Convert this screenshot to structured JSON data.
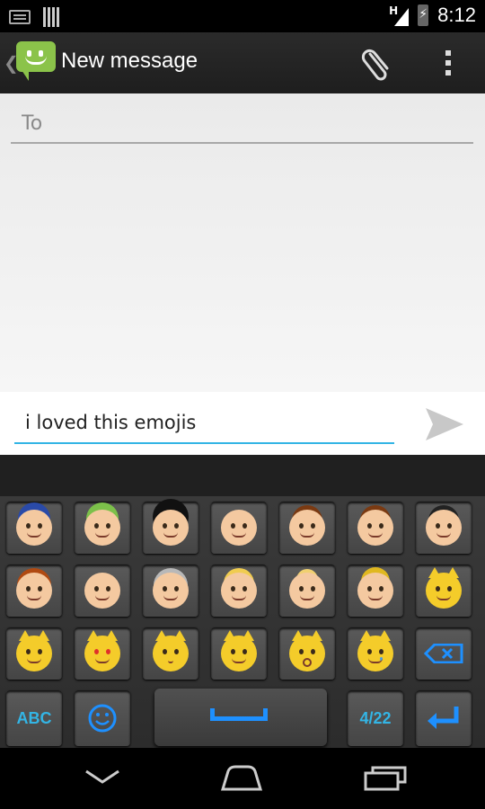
{
  "status_bar": {
    "time": "8:12",
    "network_label": "H",
    "icons": [
      "keyboard-icon",
      "barcode-icon",
      "signal-icon",
      "battery-charging-icon"
    ]
  },
  "action_bar": {
    "title": "New message",
    "icons": [
      "back-caret-icon",
      "messaging-app-icon",
      "paperclip-icon",
      "overflow-menu-icon"
    ]
  },
  "compose": {
    "to_placeholder": "To",
    "message_text": "i loved this emojis",
    "send_icon": "send-arrow-icon"
  },
  "keyboard": {
    "rows": [
      [
        "police-officer-emoji",
        "construction-worker-emoji",
        "guardsman-emoji",
        "baby-emoji",
        "boy-emoji",
        "girl-emoji",
        "man-emoji"
      ],
      [
        "woman-emoji",
        "older-man-emoji",
        "older-woman-emoji",
        "person-blond-hair-emoji",
        "angel-emoji",
        "princess-emoji",
        "smiley-cat-emoji"
      ],
      [
        "smile-cat-emoji",
        "heart-eyes-cat-emoji",
        "kissing-cat-emoji",
        "smirk-cat-emoji",
        "scream-cat-emoji",
        "crying-cat-emoji",
        "backspace-icon"
      ]
    ],
    "abc_label": "ABC",
    "page_label": "4/22",
    "accent_color": "#33b5e5"
  },
  "nav_bar": {
    "icons": [
      "back-icon",
      "home-icon",
      "recent-apps-icon"
    ]
  }
}
